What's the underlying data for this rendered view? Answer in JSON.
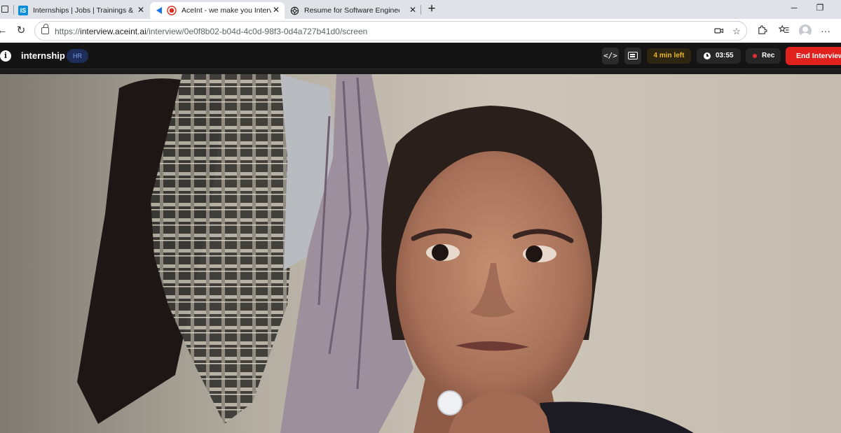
{
  "browser": {
    "tabs": [
      {
        "title": "Internships | Jobs | Trainings & Pla",
        "favicon": "is-logo-icon",
        "favicon_text": "IS",
        "active": false
      },
      {
        "title": "AceInt - we make you Intervi",
        "favicon": "record-icon",
        "active": true
      },
      {
        "title": "Resume for Software Engineer I",
        "favicon": "openai-icon",
        "active": false
      }
    ],
    "url_prefix": "https://",
    "url_host": "interview.aceint.ai",
    "url_path": "/interview/0e0f8b02-b04d-4c0d-98f3-0d4a727b41d0/screen"
  },
  "header": {
    "title": "internship",
    "badge": "HR",
    "time_left": "4 min left",
    "timer": "03:55",
    "rec_label": "Rec",
    "end_label": "End Interview"
  },
  "colors": {
    "end_button": "#e0221f",
    "time_left_text": "#e8b629",
    "badge_text": "#7b9df0",
    "rec_dot": "#e03131"
  }
}
